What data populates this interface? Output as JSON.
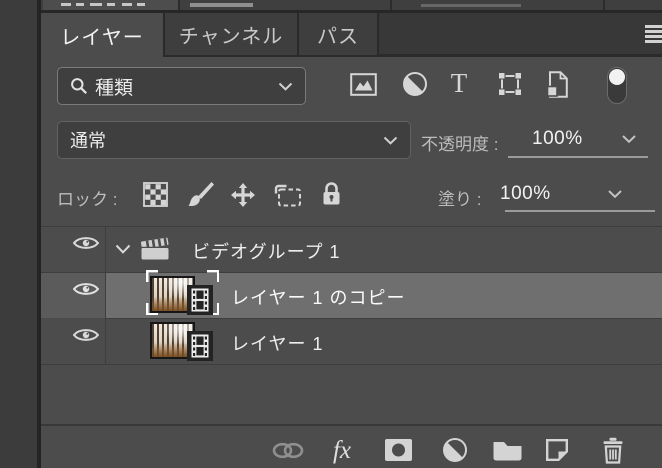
{
  "panel": {
    "tabs": [
      {
        "label": "レイヤー",
        "active": true
      },
      {
        "label": "チャンネル",
        "active": false
      },
      {
        "label": "パス",
        "active": false
      }
    ],
    "menu_icon": "panel-menu-hamburger-icon",
    "filter_row": {
      "search_icon": "search-icon",
      "kind_label": "種類",
      "filter_icons": [
        "pixel-layer-filter-icon",
        "adjustment-layer-filter-icon",
        "type-layer-filter-icon",
        "shape-layer-filter-icon",
        "smart-object-filter-icon"
      ],
      "toggle_icon": "layer-filtering-toggle"
    },
    "blend_row": {
      "blend_mode": "通常",
      "opacity_label": "不透明度 :",
      "opacity_value": "100%"
    },
    "lock_row": {
      "lock_label": "ロック :",
      "lock_icons": [
        "lock-transparent-pixels-icon",
        "lock-image-pixels-icon",
        "lock-position-icon",
        "lock-artboard-icon",
        "lock-all-icon"
      ],
      "fill_label": "塗り :",
      "fill_value": "100%"
    },
    "layers": [
      {
        "type": "video-group",
        "name": "ビデオグループ 1",
        "expanded": true,
        "visible": true,
        "selected": false
      },
      {
        "type": "video-layer",
        "name": "レイヤー 1 のコピー",
        "visible": true,
        "selected": true
      },
      {
        "type": "video-layer",
        "name": "レイヤー 1",
        "visible": true,
        "selected": false
      }
    ],
    "toolbar": {
      "fx_label": "fx",
      "icons": [
        "link-layers-icon",
        "layer-style-icon",
        "add-layer-mask-icon",
        "new-adjustment-layer-icon",
        "new-group-icon",
        "new-layer-icon",
        "delete-layer-icon"
      ]
    },
    "colors": {
      "panel_bg": "#4c4c4c",
      "tabbar_bg": "#383838",
      "control_bg": "#3f3f3f",
      "selected_row_bg": "#6f6f6f",
      "icon_color": "#d6d6d6",
      "label_color": "#bdbdbd",
      "value_color": "#f2f2f2"
    }
  }
}
